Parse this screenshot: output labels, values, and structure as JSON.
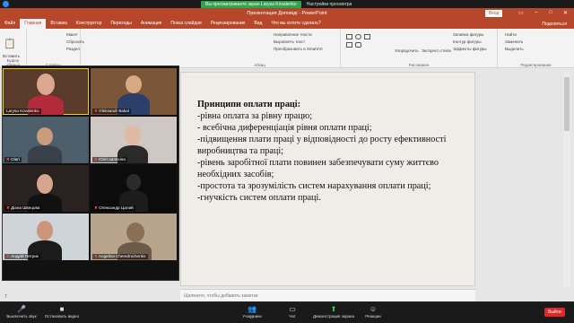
{
  "zoom": {
    "share_banner": "Вы просматриваете экран Larysa Kovalenko",
    "view_options": "Настройки просмотра",
    "toolbar": {
      "mute_label": "Выключить звук",
      "video_label": "Остановить видео",
      "participants_label": "Участники",
      "participants_count": "27",
      "chat_label": "Чат",
      "share_label": "Демонстрация экрана",
      "reactions_label": "Реакции",
      "end_label": "Выйти"
    }
  },
  "powerpoint": {
    "title": "Презентация Доповіді  -  PowerPoint",
    "signin": "Вход",
    "tabs": [
      "Файл",
      "Главная",
      "Вставка",
      "Конструктор",
      "Переходы",
      "Анимация",
      "Показ слайдов",
      "Рецензирование",
      "Вид",
      "Что вы хотите сделать?"
    ],
    "share": "Поделиться",
    "ribbon": {
      "paste": "Вставить",
      "clipboard": "Буфер обмена",
      "layout": "Макет",
      "reset": "Сбросить",
      "section": "Раздел",
      "slides_group": "Слайды",
      "paragraph_group": "Абзац",
      "text_dir": "Направление текста",
      "align_text": "Выровнять текст",
      "smartart": "Преобразовать в SmartArt",
      "arrange": "Упорядочить",
      "quick_styles": "Экспресс-стили",
      "shape_fill": "Заливка фигуры",
      "shape_outline": "Контур фигуры",
      "shape_effects": "Эффекты фигуры",
      "drawing_group": "Рисование",
      "find": "Найти",
      "replace": "Заменить",
      "select": "Выделить",
      "editing_group": "Редактирование"
    },
    "slide": {
      "heading": "Принципи оплати праці:",
      "lines": [
        "-рівна оплата за рівну працю;",
        "- всебічна диференціація рівня оплати  праці;",
        "-підвищення плати праці у відповідності до росту ефективності виробництва та праці;",
        "-рівень заробітної плати повинен забезпечувати суму життєво необхідних засобів;",
        "-простота та зрозумілість систем нарахування оплати праці;",
        "-гнучкість систем оплати праці."
      ]
    },
    "notes_placeholder": "Щелкните, чтобы добавить заметки",
    "slide_number": "7"
  },
  "participants": [
    {
      "name": "Larysa Kovalenko"
    },
    {
      "name": "Oleksandr Bakal"
    },
    {
      "name": "Olari"
    },
    {
      "name": "Юлія Шляхіна"
    },
    {
      "name": "Діана Швецова"
    },
    {
      "name": "Олександр Цалий"
    },
    {
      "name": "Андрій Петрик"
    },
    {
      "name": "Angelina Cherednichenko"
    }
  ],
  "colors": {
    "ppt_accent": "#b7472a",
    "zoom_green": "#2da44e",
    "end_red": "#e02828",
    "speaker_yellow": "#f1d30c"
  }
}
